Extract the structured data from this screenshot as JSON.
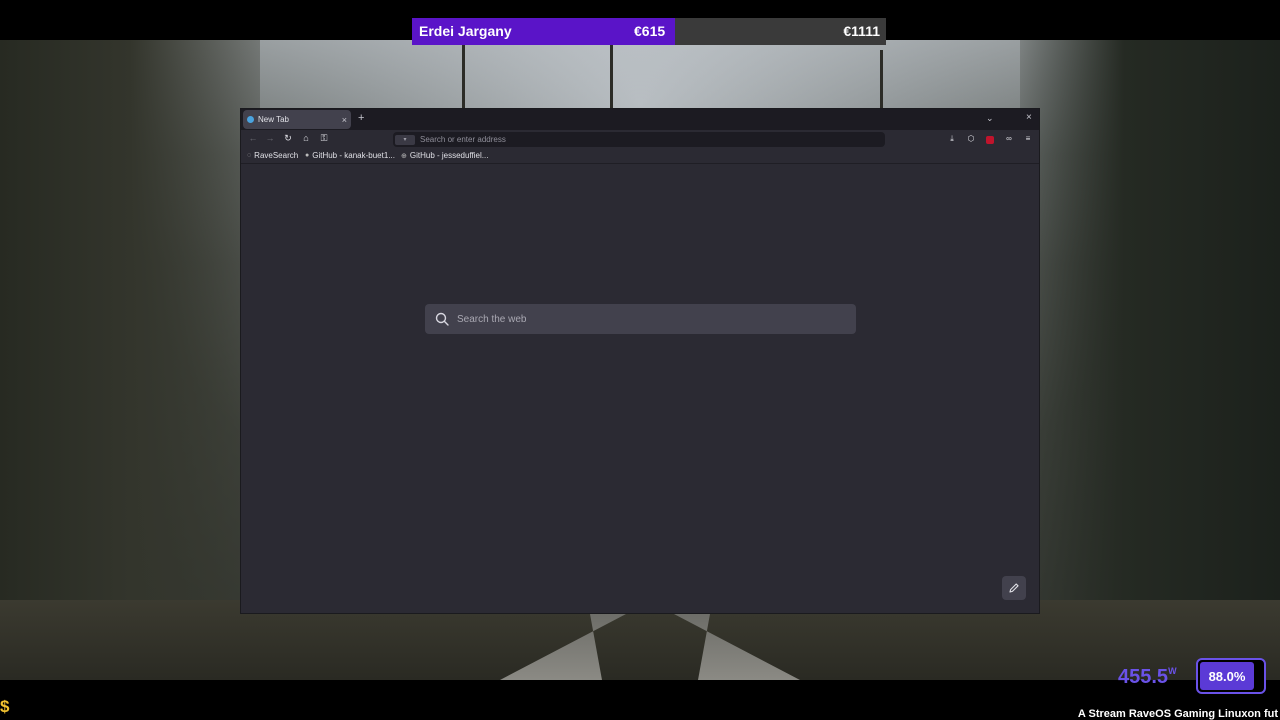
{
  "overlay": {
    "donor_name": "Erdei Jargany",
    "donation_amount": "€615",
    "goal_amount": "€1111",
    "donation_progress": 0.555
  },
  "browser": {
    "tab_title": "New Tab",
    "tab_close": "×",
    "new_tab": "+",
    "tab_list": "⌄",
    "window_close": "×",
    "nav": {
      "back": "←",
      "forward": "→",
      "reload": "↻",
      "home": "⌂",
      "key": "⚿"
    },
    "url_placeholder": "Search or enter address",
    "toolbar_icons": [
      "download-icon",
      "extensions-icon",
      "ublock-icon",
      "glasses-icon",
      "menu-icon"
    ],
    "bookmarks": [
      {
        "label": "RaveSearch",
        "icon": "rave-icon"
      },
      {
        "label": "GitHub - kanak-buet1...",
        "icon": "github-icon"
      },
      {
        "label": "GitHub - jesseduffiel...",
        "icon": "globe-icon"
      }
    ],
    "search_placeholder": "Search the web"
  },
  "status": {
    "power": "455.5",
    "power_unit": "W",
    "battery": "88.0%",
    "ticker": "A Stream RaveOS Gaming Linuxon fut"
  },
  "colors": {
    "accent_purple": "#5a14c8",
    "battery_purple": "#5b3ad6",
    "browser_bg": "#2b2a33"
  }
}
